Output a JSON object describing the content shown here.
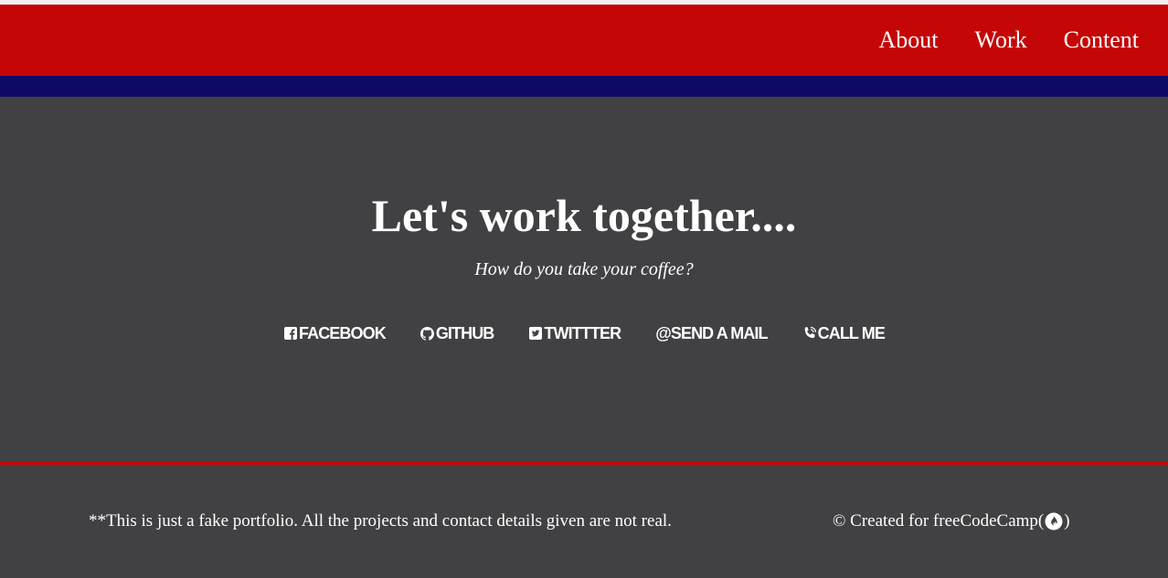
{
  "nav": {
    "links": [
      {
        "label": "About"
      },
      {
        "label": "Work"
      },
      {
        "label": "Content"
      }
    ]
  },
  "contact": {
    "heading": "Let's work together....",
    "subheading": "How do you take your coffee?",
    "links": [
      {
        "label": "FACEBOOK",
        "icon": "facebook-icon"
      },
      {
        "label": "GITHUB",
        "icon": "github-icon"
      },
      {
        "label": "TWITTTER",
        "icon": "twitter-icon"
      },
      {
        "label": "SEND A MAIL",
        "icon": "at-icon"
      },
      {
        "label": "CALL ME",
        "icon": "phone-icon"
      }
    ]
  },
  "footer": {
    "note": "**This is just a fake portfolio. All the projects and contact details given are not real.",
    "credit_prefix": "© Created for freeCodeCamp(",
    "credit_suffix": ")",
    "credit_icon": "free-code-camp-icon"
  },
  "colors": {
    "navbar": "#c40606",
    "navband": "#0c0a66",
    "background": "#414042",
    "text": "#ffffff"
  }
}
